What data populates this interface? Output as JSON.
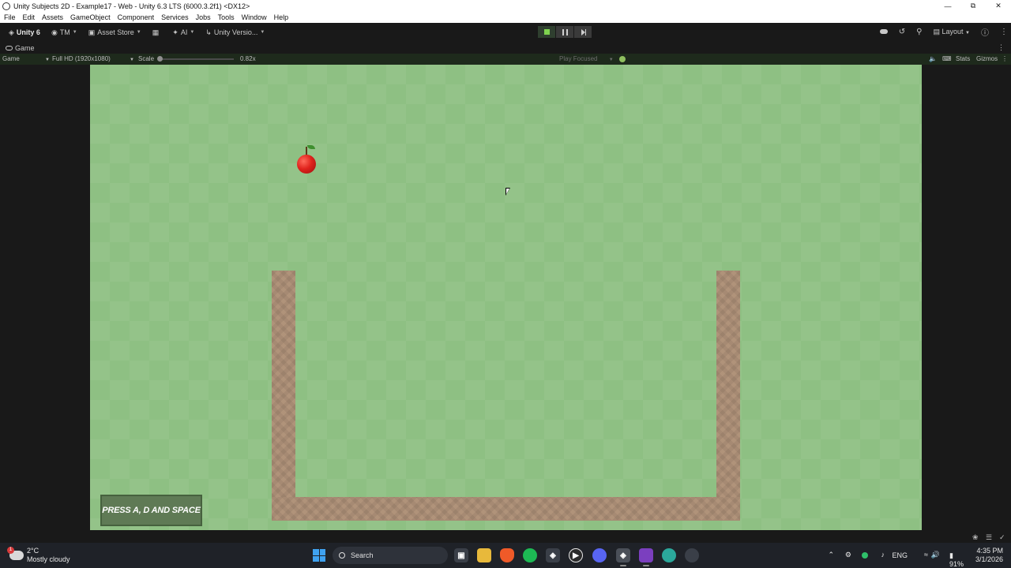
{
  "window": {
    "title": "Unity Subjects 2D - Example17 - Web - Unity 6.3 LTS (6000.3.2f1) <DX12>",
    "controls": [
      "minimize-icon",
      "restore-icon",
      "close-icon"
    ]
  },
  "menu": {
    "items": [
      "File",
      "Edit",
      "Assets",
      "GameObject",
      "Component",
      "Services",
      "Jobs",
      "Tools",
      "Window",
      "Help"
    ]
  },
  "toolbar": {
    "unity_label": "Unity 6",
    "account_label": "TM",
    "asset_store_label": "Asset Store",
    "ai_label": "AI",
    "version_control_label": "Unity Versio...",
    "layout_label": "Layout",
    "play_state": "playing",
    "accent_color": "#7fd44f"
  },
  "tab": {
    "label": "Game"
  },
  "gamebar": {
    "view_label": "Game",
    "resolution": "Full HD (1920x1080)",
    "scale_label": "Scale",
    "scale_value": "0.82x",
    "play_mode": "Play Focused",
    "stats_label": "Stats",
    "gizmos_label": "Gizmos"
  },
  "game": {
    "hint_text": "PRESS A, D AND SPACE",
    "background_color": "#8ec083",
    "wall_color": "#b0937a",
    "objects": [
      "apple",
      "u-shaped-container"
    ]
  },
  "taskbar": {
    "weather_temp": "2°C",
    "weather_desc": "Mostly cloudy",
    "weather_alert": "1",
    "search_placeholder": "Search",
    "language": "ENG",
    "battery": "91%",
    "time": "4:35 PM",
    "date": "3/1/2026"
  }
}
